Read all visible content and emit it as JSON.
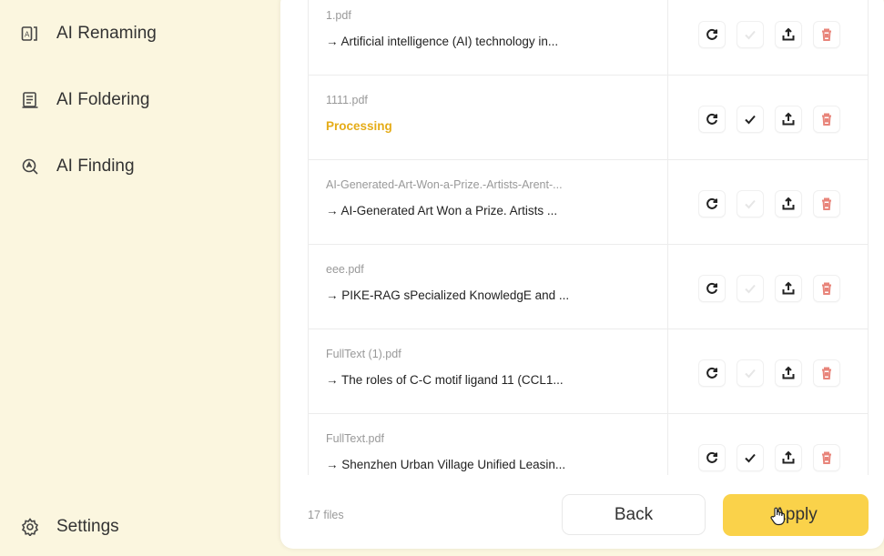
{
  "sidebar": {
    "items": [
      {
        "label": "AI Renaming",
        "icon": "ai-text-icon"
      },
      {
        "label": "AI Foldering",
        "icon": "document-list-icon"
      },
      {
        "label": "AI Finding",
        "icon": "search-ai-icon"
      }
    ],
    "settings": {
      "label": "Settings",
      "icon": "gear-icon"
    }
  },
  "files": [
    {
      "original": "1.pdf",
      "renamed": "→  Artificial intelligence (AI) technology in...",
      "status": "done",
      "confirmed": false
    },
    {
      "original": "1111.pdf",
      "renamed": "Processing",
      "status": "processing",
      "confirmed": true
    },
    {
      "original": "AI-Generated-Art-Won-a-Prize.-Artists-Arent-...",
      "renamed": "→  AI-Generated Art Won a Prize. Artists ...",
      "status": "done",
      "confirmed": false
    },
    {
      "original": "eee.pdf",
      "renamed": "→  PIKE-RAG sPecialized KnowledgE and ...",
      "status": "done",
      "confirmed": false
    },
    {
      "original": "FullText (1).pdf",
      "renamed": "→  The roles of C-C motif ligand 11 (CCL1...",
      "status": "done",
      "confirmed": false
    },
    {
      "original": "FullText.pdf",
      "renamed": "→  Shenzhen Urban Village Unified Leasin...",
      "status": "done",
      "confirmed": true
    }
  ],
  "footer": {
    "count": "17 files",
    "back_label": "Back",
    "apply_label": "Apply"
  },
  "colors": {
    "sidebar_bg": "#fbf6df",
    "accent": "#fad24a",
    "processing": "#e5ac18",
    "delete": "#e8847a"
  }
}
